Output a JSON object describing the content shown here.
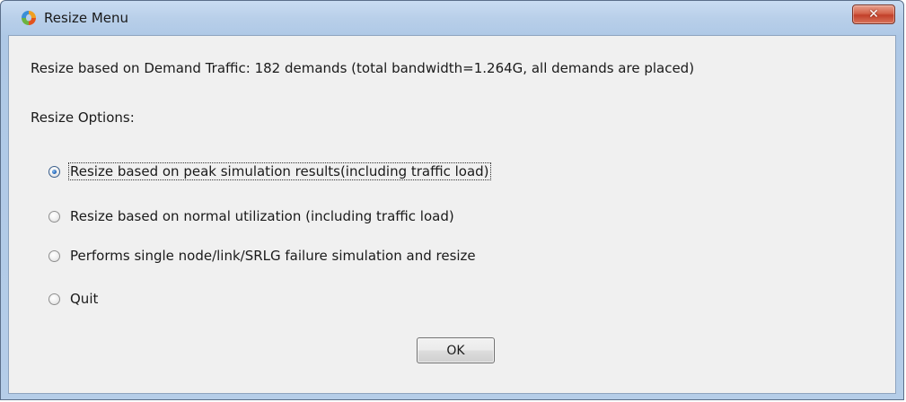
{
  "window": {
    "title": "Resize Menu",
    "close_label": "✕",
    "icon": "app-logo-icon"
  },
  "content": {
    "info_text": "Resize based on Demand Traffic: 182 demands (total bandwidth=1.264G, all demands are placed)",
    "options_label": "Resize Options:",
    "options": [
      {
        "label": "Resize based on peak simulation results(including traffic load)",
        "checked": true
      },
      {
        "label": "Resize based on normal utilization (including traffic load)",
        "checked": false
      },
      {
        "label": "Performs single node/link/SRLG failure simulation and resize",
        "checked": false
      },
      {
        "label": "Quit",
        "checked": false
      }
    ],
    "ok_label": "OK"
  },
  "colors": {
    "title_bar": "#b8cfe9",
    "close_button": "#c94a32",
    "dialog_background": "#f0f0f0",
    "radio_selected": "#2a6bbd"
  }
}
